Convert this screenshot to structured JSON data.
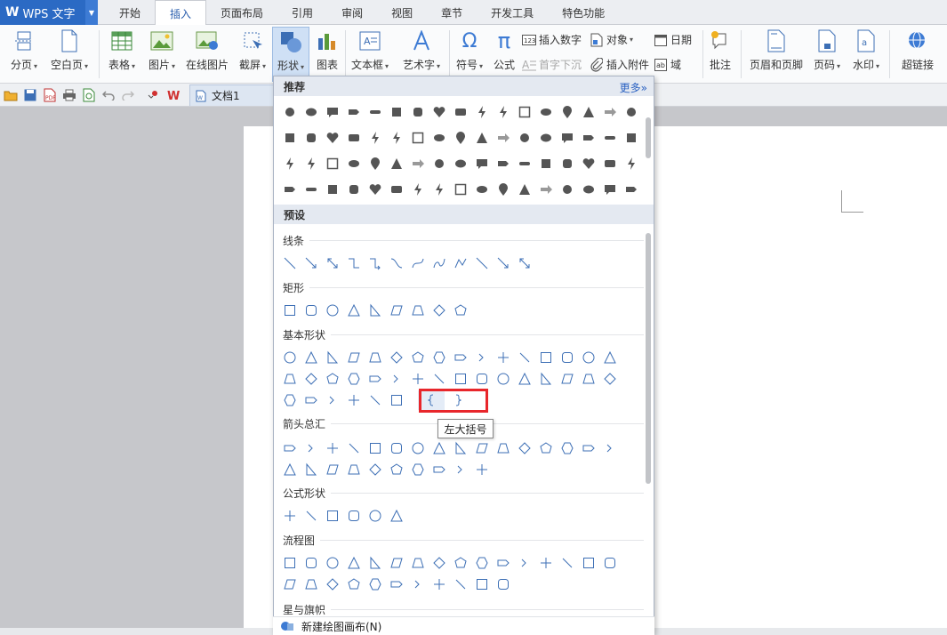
{
  "app": {
    "title": "WPS 文字"
  },
  "tabs": [
    "开始",
    "插入",
    "页面布局",
    "引用",
    "审阅",
    "视图",
    "章节",
    "开发工具",
    "特色功能"
  ],
  "active_tab": "插入",
  "ribbon": {
    "page_break": "分页",
    "blank_page": "空白页",
    "table": "表格",
    "picture": "图片",
    "online_picture": "在线图片",
    "screenshot": "截屏",
    "shapes": "形状",
    "chart": "图表",
    "textbox": "文本框",
    "wordart": "艺术字",
    "symbol": "符号",
    "formula": "公式",
    "insert_number": "插入数字",
    "object": "对象",
    "date": "日期",
    "dropcap": "首字下沉",
    "attachment": "插入附件",
    "field": "域",
    "comment": "批注",
    "header_footer": "页眉和页脚",
    "page_number": "页码",
    "watermark": "水印",
    "hyperlink": "超链接"
  },
  "document": {
    "tab_name": "文档1"
  },
  "shapes_menu": {
    "recommended_header": "推荐",
    "more_link": "更多»",
    "presets_header": "预设",
    "categories": {
      "lines": "线条",
      "rectangles": "矩形",
      "basic": "基本形状",
      "arrows": "箭头总汇",
      "equation": "公式形状",
      "flowchart": "流程图",
      "stars": "星与旗帜"
    },
    "tooltip": "左大括号",
    "new_canvas": "新建绘图画布(N)"
  },
  "colors": {
    "accent": "#2b6ac4",
    "highlight_box": "#e8262b",
    "shape_outline": "#3d6fb5",
    "shape_fill_recommended": "#555555"
  }
}
